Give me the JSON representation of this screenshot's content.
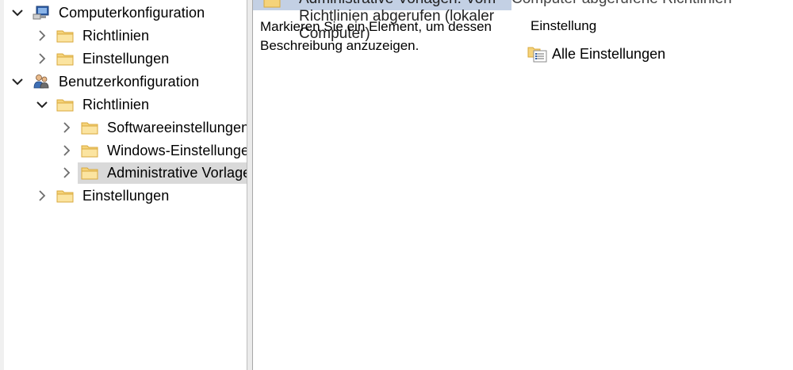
{
  "tree": {
    "items": [
      {
        "label": "Computerkonfiguration",
        "icon": "computer-icon",
        "expanded": true
      },
      {
        "label": "Richtlinien",
        "icon": "folder-icon",
        "expanded": false
      },
      {
        "label": "Einstellungen",
        "icon": "folder-icon",
        "expanded": false
      },
      {
        "label": "Benutzerkonfiguration",
        "icon": "users-icon",
        "expanded": true
      },
      {
        "label": "Richtlinien",
        "icon": "folder-icon",
        "expanded": true
      },
      {
        "label": "Softwareeinstellungen",
        "icon": "folder-icon",
        "expanded": false
      },
      {
        "label": "Windows-Einstellungen",
        "icon": "folder-icon",
        "expanded": false
      },
      {
        "label": "Administrative Vorlagen",
        "icon": "folder-icon",
        "expanded": false,
        "selected": true
      },
      {
        "label": "Einstellungen",
        "icon": "folder-icon",
        "expanded": false
      }
    ]
  },
  "details": {
    "header_text": "Administrative Vorlagen: Vom Richtlinien abgerufen (lokaler Computer)",
    "header_text_right": "Computer abgerufene Richtlinien",
    "description": "Markieren Sie ein Element, um dessen Beschreibung anzuzeigen.",
    "column_header": "Einstellung",
    "items": [
      {
        "label": "Alle Einstellungen",
        "icon": "settings-list-icon"
      }
    ]
  },
  "colors": {
    "selection": "#d9d9d9",
    "header_strip": "#c3d0e4",
    "folder": "#f5d37a",
    "chevron": "#6d6d6d"
  }
}
